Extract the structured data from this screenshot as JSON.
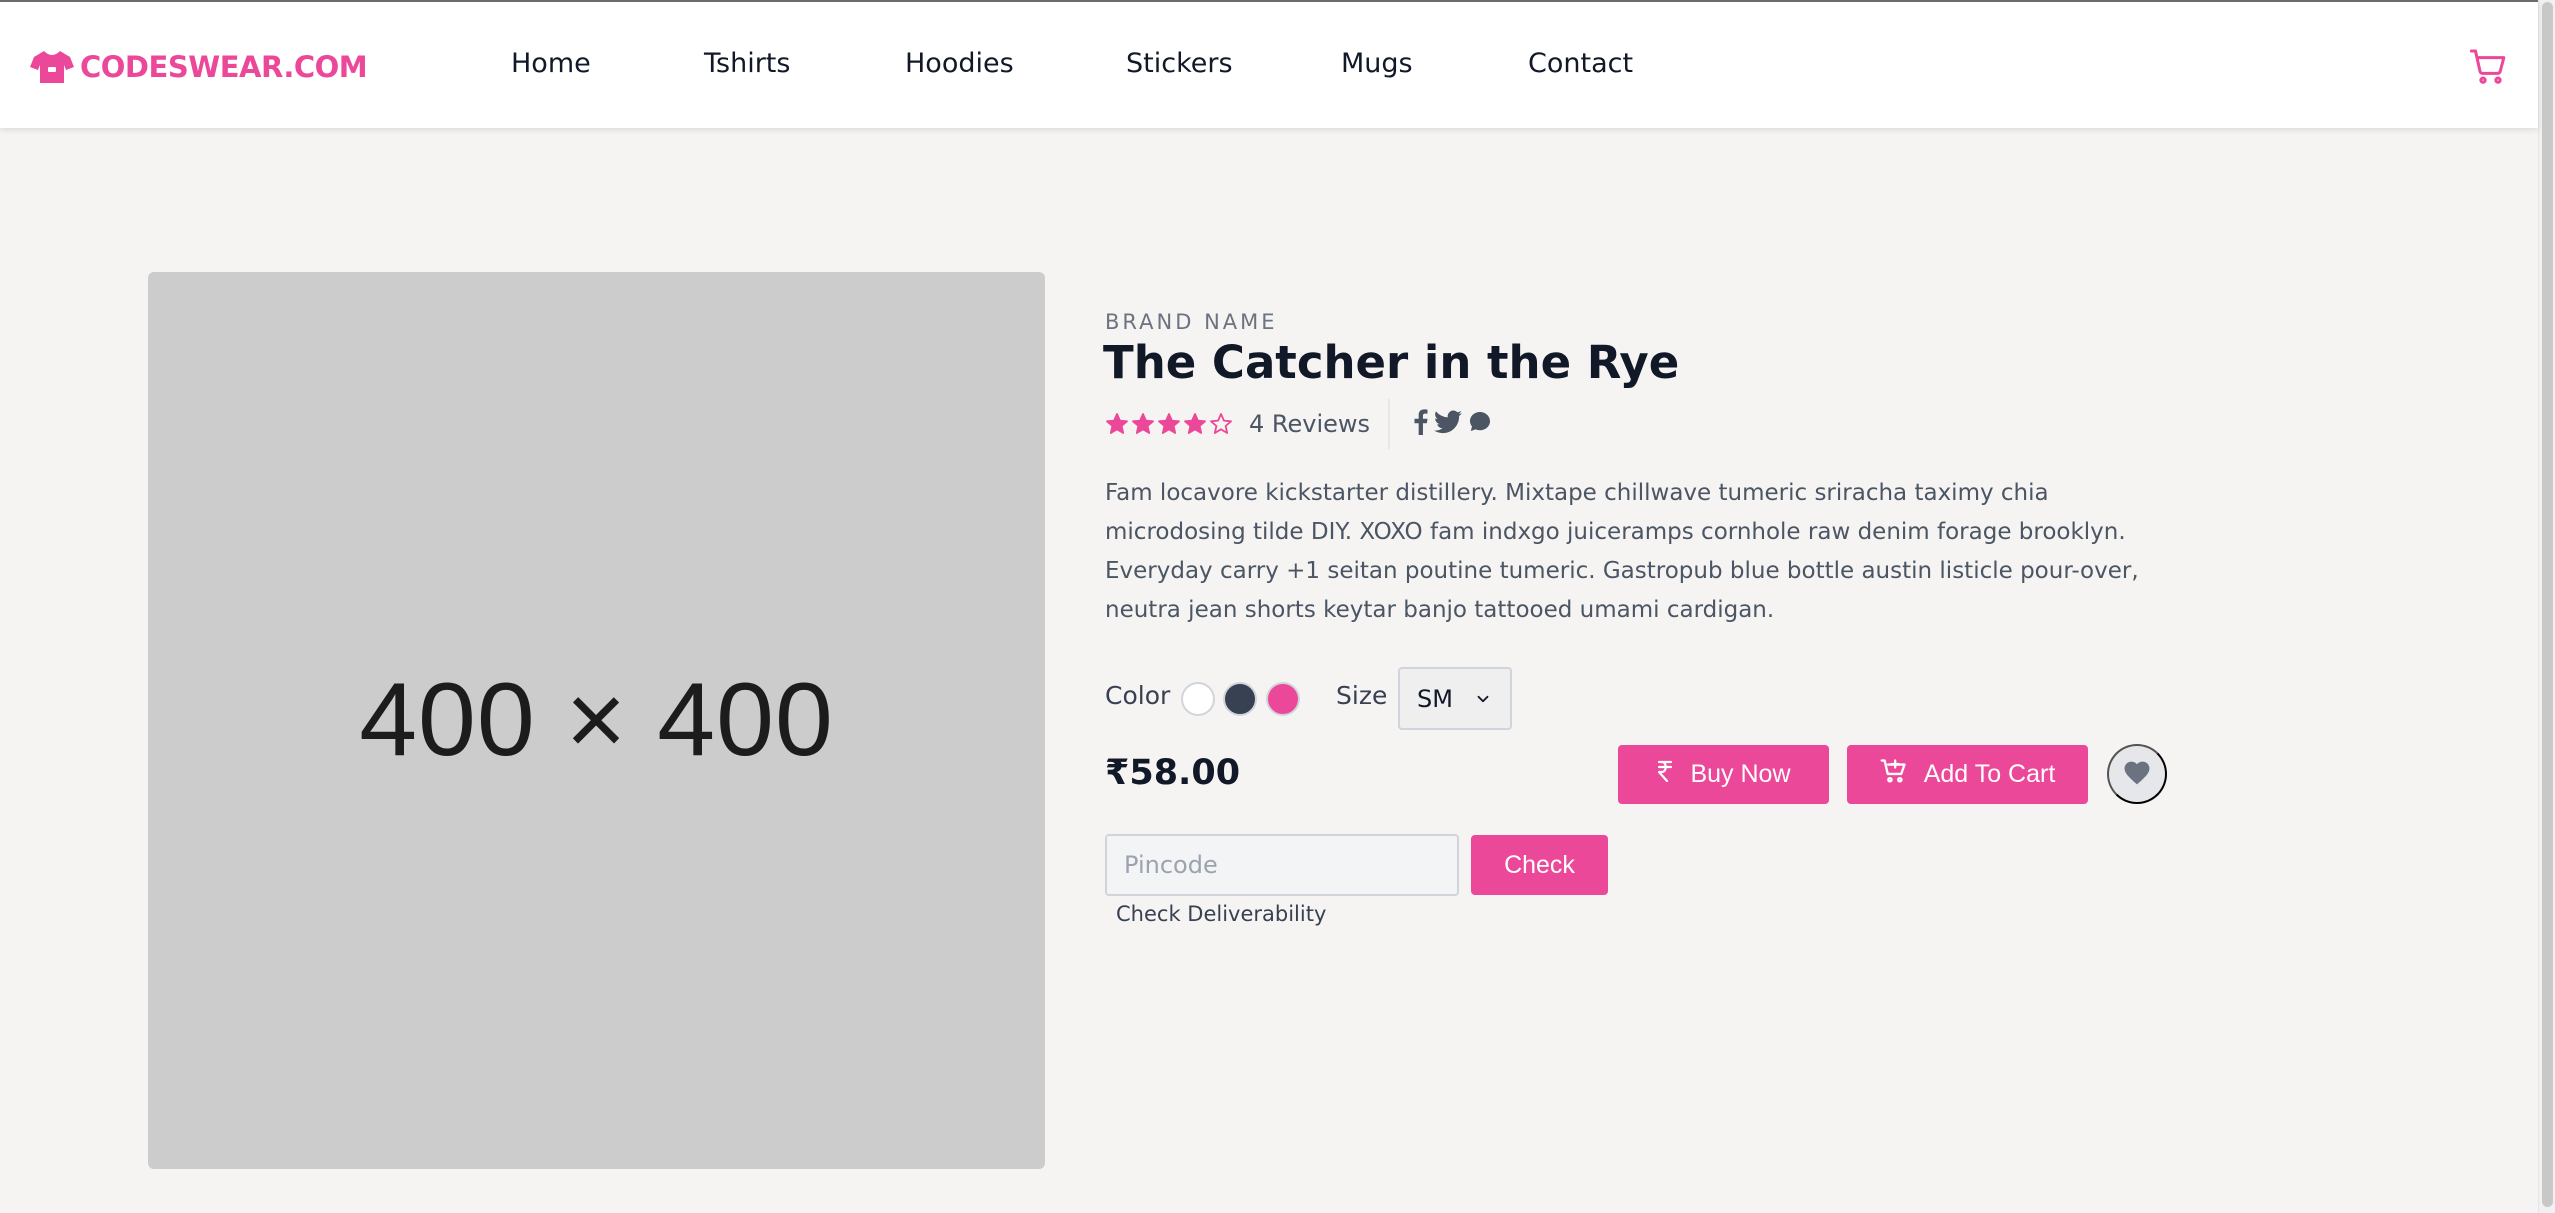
{
  "header": {
    "logo_text": "CODESWEAR.COM",
    "nav": [
      "Home",
      "Tshirts",
      "Hoodies",
      "Stickers",
      "Mugs",
      "Contact"
    ],
    "cart_icon": "shopping-cart-icon"
  },
  "product": {
    "image_placeholder": "400 × 400",
    "brand": "BRAND NAME",
    "title": "The Catcher in the Rye",
    "rating": 4,
    "rating_max": 5,
    "reviews_label": "4 Reviews",
    "socials": [
      "facebook-icon",
      "twitter-icon",
      "chat-icon"
    ],
    "description": "Fam locavore kickstarter distillery. Mixtape chillwave tumeric sriracha taximy chia microdosing tilde DIY. XOXO fam indxgo juiceramps cornhole raw denim forage brooklyn. Everyday carry +1 seitan poutine tumeric. Gastropub blue bottle austin listicle pour-over, neutra jean shorts keytar banjo tattooed umami cardigan.",
    "color_label": "Color",
    "colors": [
      "#ffffff",
      "#374151",
      "#ec4899"
    ],
    "size_label": "Size",
    "size_selected": "SM",
    "price": "₹58.00",
    "buy_now_label": "Buy Now",
    "add_to_cart_label": "Add To Cart",
    "pincode_placeholder": "Pincode",
    "check_label": "Check",
    "check_deliverability_label": "Check Deliverability"
  },
  "theme": {
    "accent": "#ec4899",
    "background": "#f5f4f3"
  }
}
